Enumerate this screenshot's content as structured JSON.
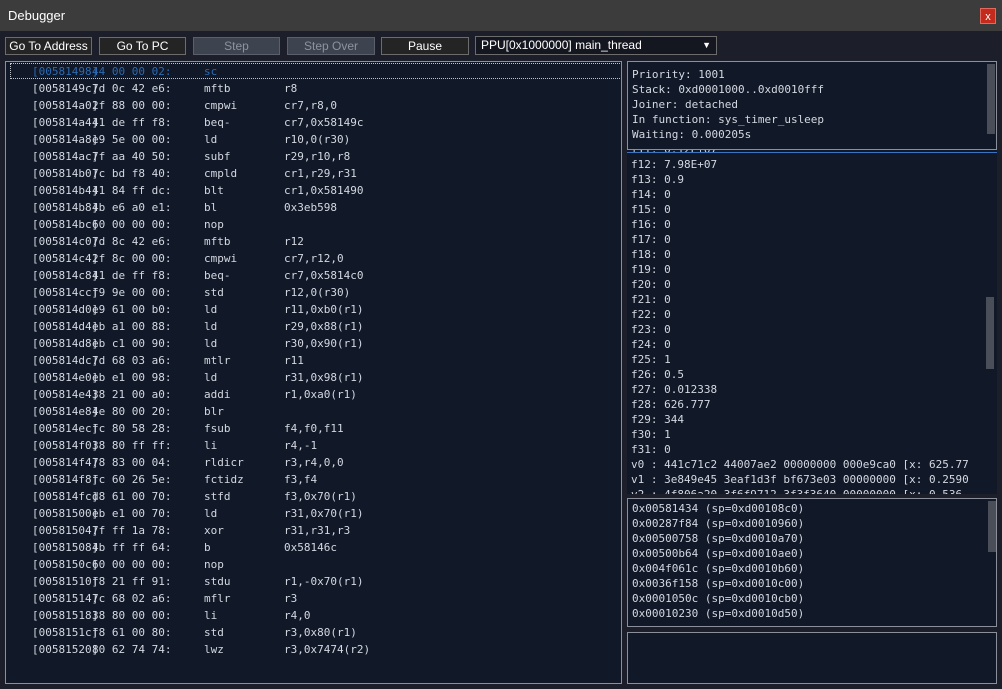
{
  "window": {
    "title": "Debugger",
    "close_label": "x"
  },
  "toolbar": {
    "go_to_address": "Go To Address",
    "go_to_pc": "Go To PC",
    "step": "Step",
    "step_over": "Step Over",
    "pause": "Pause",
    "thread_select": "PPU[0x1000000] main_thread"
  },
  "disasm": [
    {
      "addr": "[00581498]",
      "bytes": "44 00 00 02:",
      "mn": "sc",
      "op": ""
    },
    {
      "addr": "[0058149c]",
      "bytes": "7d 0c 42 e6:",
      "mn": "mftb",
      "op": "r8"
    },
    {
      "addr": "[005814a0]",
      "bytes": "2f 88 00 00:",
      "mn": "cmpwi",
      "op": "cr7,r8,0"
    },
    {
      "addr": "[005814a4]",
      "bytes": "41 de ff f8:",
      "mn": "beq-",
      "op": "cr7,0x58149c"
    },
    {
      "addr": "[005814a8]",
      "bytes": "e9 5e 00 00:",
      "mn": "ld",
      "op": "r10,0(r30)"
    },
    {
      "addr": "[005814ac]",
      "bytes": "7f aa 40 50:",
      "mn": "subf",
      "op": "r29,r10,r8"
    },
    {
      "addr": "[005814b0]",
      "bytes": "7c bd f8 40:",
      "mn": "cmpld",
      "op": "cr1,r29,r31"
    },
    {
      "addr": "[005814b4]",
      "bytes": "41 84 ff dc:",
      "mn": "blt",
      "op": "cr1,0x581490"
    },
    {
      "addr": "[005814b8]",
      "bytes": "4b e6 a0 e1:",
      "mn": "bl",
      "op": "0x3eb598"
    },
    {
      "addr": "[005814bc]",
      "bytes": "60 00 00 00:",
      "mn": "nop",
      "op": ""
    },
    {
      "addr": "[005814c0]",
      "bytes": "7d 8c 42 e6:",
      "mn": "mftb",
      "op": "r12"
    },
    {
      "addr": "[005814c4]",
      "bytes": "2f 8c 00 00:",
      "mn": "cmpwi",
      "op": "cr7,r12,0"
    },
    {
      "addr": "[005814c8]",
      "bytes": "41 de ff f8:",
      "mn": "beq-",
      "op": "cr7,0x5814c0"
    },
    {
      "addr": "[005814cc]",
      "bytes": "f9 9e 00 00:",
      "mn": "std",
      "op": "r12,0(r30)"
    },
    {
      "addr": "[005814d0]",
      "bytes": "e9 61 00 b0:",
      "mn": "ld",
      "op": "r11,0xb0(r1)"
    },
    {
      "addr": "[005814d4]",
      "bytes": "eb a1 00 88:",
      "mn": "ld",
      "op": "r29,0x88(r1)"
    },
    {
      "addr": "[005814d8]",
      "bytes": "eb c1 00 90:",
      "mn": "ld",
      "op": "r30,0x90(r1)"
    },
    {
      "addr": "[005814dc]",
      "bytes": "7d 68 03 a6:",
      "mn": "mtlr",
      "op": "r11"
    },
    {
      "addr": "[005814e0]",
      "bytes": "eb e1 00 98:",
      "mn": "ld",
      "op": "r31,0x98(r1)"
    },
    {
      "addr": "[005814e4]",
      "bytes": "38 21 00 a0:",
      "mn": "addi",
      "op": "r1,0xa0(r1)"
    },
    {
      "addr": "[005814e8]",
      "bytes": "4e 80 00 20:",
      "mn": "blr",
      "op": ""
    },
    {
      "addr": "[005814ec]",
      "bytes": "fc 80 58 28:",
      "mn": "fsub",
      "op": "f4,f0,f11"
    },
    {
      "addr": "[005814f0]",
      "bytes": "38 80 ff ff:",
      "mn": "li",
      "op": "r4,-1"
    },
    {
      "addr": "[005814f4]",
      "bytes": "78 83 00 04:",
      "mn": "rldicr",
      "op": "r3,r4,0,0"
    },
    {
      "addr": "[005814f8]",
      "bytes": "fc 60 26 5e:",
      "mn": "fctidz",
      "op": "f3,f4"
    },
    {
      "addr": "[005814fc]",
      "bytes": "d8 61 00 70:",
      "mn": "stfd",
      "op": "f3,0x70(r1)"
    },
    {
      "addr": "[00581500]",
      "bytes": "eb e1 00 70:",
      "mn": "ld",
      "op": "r31,0x70(r1)"
    },
    {
      "addr": "[00581504]",
      "bytes": "7f ff 1a 78:",
      "mn": "xor",
      "op": "r31,r31,r3"
    },
    {
      "addr": "[00581508]",
      "bytes": "4b ff ff 64:",
      "mn": "b",
      "op": "0x58146c"
    },
    {
      "addr": "[0058150c]",
      "bytes": "60 00 00 00:",
      "mn": "nop",
      "op": ""
    },
    {
      "addr": "[00581510]",
      "bytes": "f8 21 ff 91:",
      "mn": "stdu",
      "op": "r1,-0x70(r1)"
    },
    {
      "addr": "[00581514]",
      "bytes": "7c 68 02 a6:",
      "mn": "mflr",
      "op": "r3"
    },
    {
      "addr": "[00581518]",
      "bytes": "38 80 00 00:",
      "mn": "li",
      "op": "r4,0"
    },
    {
      "addr": "[0058151c]",
      "bytes": "f8 61 00 80:",
      "mn": "std",
      "op": "r3,0x80(r1)"
    },
    {
      "addr": "[00581520]",
      "bytes": "80 62 74 74:",
      "mn": "lwz",
      "op": "r3,0x7474(r2)"
    }
  ],
  "thread_info": [
    "Priority: 1001",
    "Stack: 0xd0001000..0xd0010fff",
    "Joiner: detached",
    "In function: sys_timer_usleep",
    "Waiting: 0.000205s"
  ],
  "registers": [
    "f11: 0.12E+07",
    "f12: 7.98E+07",
    "f13: 0.9",
    "f14: 0",
    "f15: 0",
    "f16: 0",
    "f17: 0",
    "f18: 0",
    "f19: 0",
    "f20: 0",
    "f21: 0",
    "f22: 0",
    "f23: 0",
    "f24: 0",
    "f25: 1",
    "f26: 0.5",
    "f27: 0.012338",
    "f28: 626.777",
    "f29: 344",
    "f30: 1",
    "f31: 0",
    "v0 : 441c71c2 44007ae2 00000000 000e9ca0 [x: 625.77",
    "v1 : 3e849e45 3eaf1d3f bf673e03 00000000 [x: 0.2590",
    "v2 : 4f806a20 3f6f9712 3f3f3640 00000000 [x: 0.536"
  ],
  "callstack": [
    "0x00581434 (sp=0xd00108c0)",
    "0x00287f84 (sp=0xd0010960)",
    "0x00500758 (sp=0xd0010a70)",
    "0x00500b64 (sp=0xd0010ae0)",
    "0x004f061c (sp=0xd0010b60)",
    "0x0036f158 (sp=0xd0010c00)",
    "0x0001050c (sp=0xd0010cb0)",
    "0x00010230 (sp=0xd0010d50)"
  ]
}
